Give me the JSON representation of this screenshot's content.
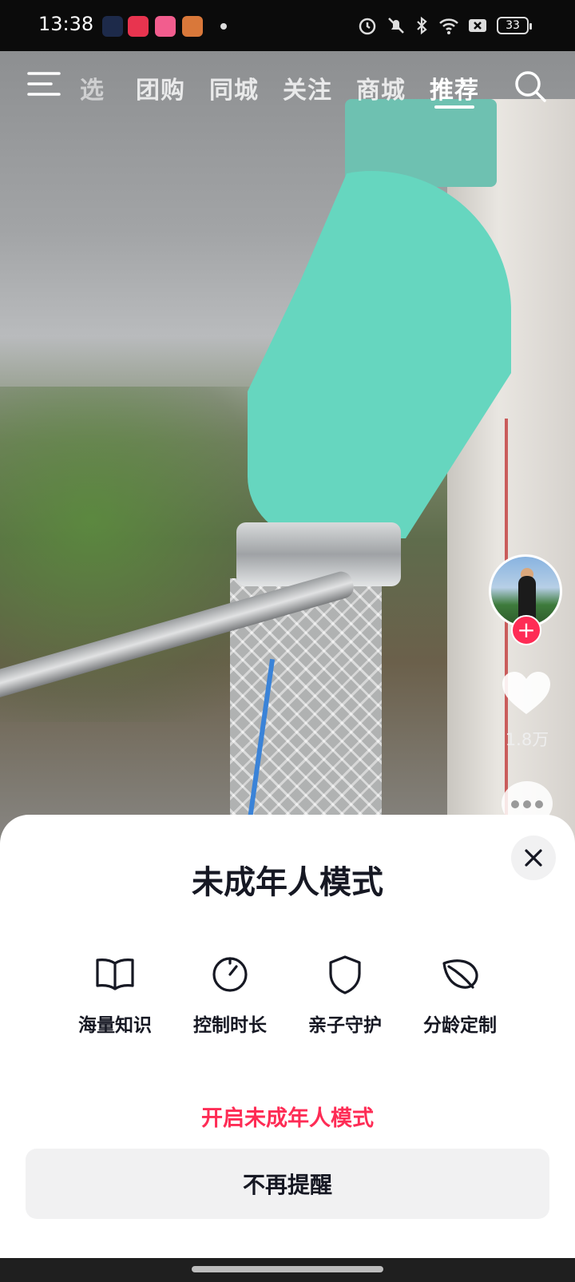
{
  "status_bar": {
    "time": "13:38",
    "battery": "33",
    "icons": [
      "app-icon-messages",
      "app-icon-music",
      "app-icon-bilibili",
      "app-icon-game",
      "notification-dot",
      "alarm-icon",
      "mute-icon",
      "bluetooth-icon",
      "wifi-icon",
      "sim-off-icon",
      "battery-icon"
    ]
  },
  "top_nav": {
    "tabs": [
      {
        "label": "选",
        "active": false
      },
      {
        "label": "团购",
        "active": false
      },
      {
        "label": "同城",
        "active": false
      },
      {
        "label": "关注",
        "active": false
      },
      {
        "label": "商城",
        "active": false
      },
      {
        "label": "推荐",
        "active": true
      }
    ]
  },
  "right_rail": {
    "like_count": "1.8万",
    "follow_symbol": "+"
  },
  "sheet": {
    "title": "未成年人模式",
    "features": [
      {
        "label": "海量知识",
        "icon": "book-icon"
      },
      {
        "label": "控制时长",
        "icon": "timer-icon"
      },
      {
        "label": "亲子守护",
        "icon": "shield-icon"
      },
      {
        "label": "分龄定制",
        "icon": "leaf-icon"
      }
    ],
    "enable_link": "开启未成年人模式",
    "dismiss_button": "不再提醒"
  },
  "colors": {
    "accent": "#fe2c55",
    "sheet_bg": "#ffffff",
    "button_bg": "#f1f1f2",
    "text": "#161823"
  }
}
